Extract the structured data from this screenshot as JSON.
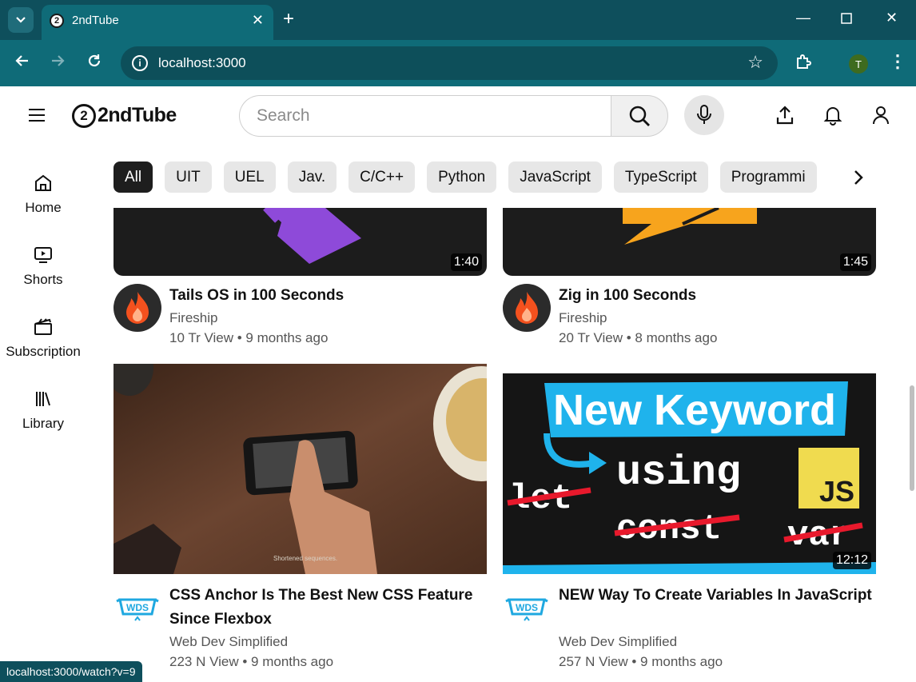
{
  "browser": {
    "tab_title": "2ndTube",
    "favicon_text": "2",
    "url": "localhost:3000",
    "profile_initial": "T",
    "status_url": "localhost:3000/watch?v=9"
  },
  "header": {
    "logo_mark": "2",
    "logo_text": "2ndTube",
    "search_placeholder": "Search"
  },
  "sidebar": {
    "items": [
      {
        "label": "Home",
        "icon": "home-icon"
      },
      {
        "label": "Shorts",
        "icon": "shorts-icon"
      },
      {
        "label": "Subscription",
        "icon": "subscription-icon"
      },
      {
        "label": "Library",
        "icon": "library-icon"
      }
    ]
  },
  "chips": [
    "All",
    "UIT",
    "UEL",
    "Jav.",
    "C/C++",
    "Python",
    "JavaScript",
    "TypeScript",
    "Programmi"
  ],
  "videos": [
    {
      "title": "Tails OS in 100 Seconds",
      "channel": "Fireship",
      "meta": "10 Tr View • 9 months ago",
      "duration": "1:40",
      "channel_color": "#2b2b2b"
    },
    {
      "title": "Zig in 100 Seconds",
      "channel": "Fireship",
      "meta": "20 Tr View • 8 months ago",
      "duration": "1:45",
      "channel_color": "#2b2b2b"
    },
    {
      "title": "CSS Anchor Is The Best New CSS Feature Since Flexbox",
      "channel": "Web Dev Simplified",
      "meta": "223 N View • 9 months ago",
      "duration": "",
      "channel_color": "#ffffff"
    },
    {
      "title": "NEW Way To Create Variables In JavaScript",
      "channel": "Web Dev Simplified",
      "meta": "257 N View • 9 months ago",
      "duration": "12:12",
      "channel_color": "#ffffff"
    }
  ],
  "thumb_text": {
    "video4_headline": "New Keyword",
    "video4_using": "using",
    "video4_let": "let",
    "video4_const": "const",
    "video4_var": "var",
    "video4_js": "JS",
    "video3_caption": "Shortened sequences.",
    "wds_logo": "WDS"
  },
  "colors": {
    "chrome_dark": "#0e4f5c",
    "chrome": "#0f6b78",
    "fireship_orange": "#f4511e",
    "wds_blue": "#1fa8e0",
    "js_yellow": "#f0db4f"
  }
}
